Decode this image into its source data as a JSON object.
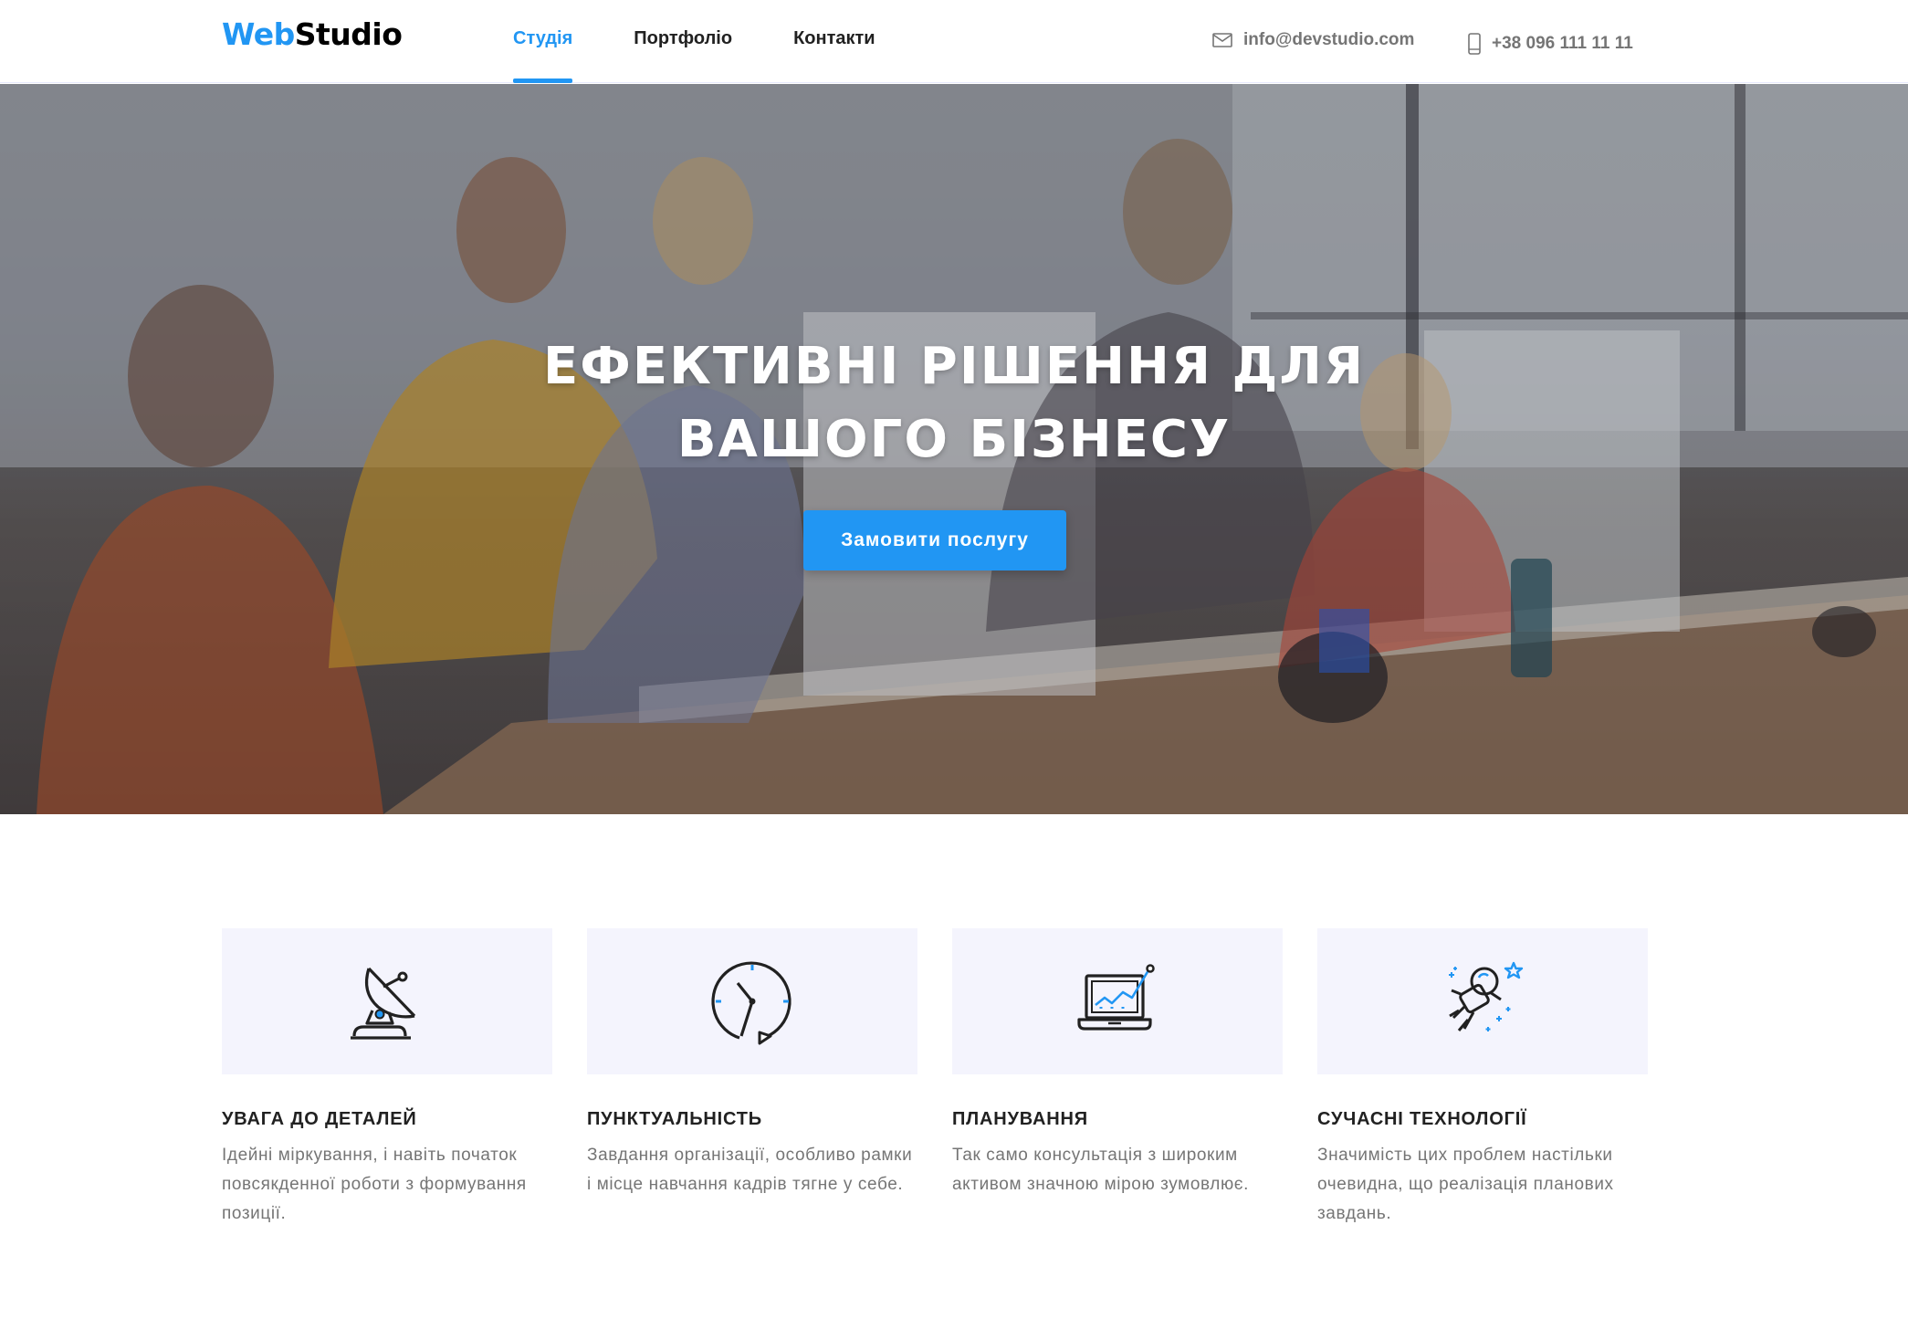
{
  "header": {
    "logo": {
      "part1": "Web",
      "part2": "Studio"
    },
    "nav": [
      {
        "label": "Студія",
        "active": true
      },
      {
        "label": "Портфоліо",
        "active": false
      },
      {
        "label": "Контакти",
        "active": false
      }
    ],
    "email": "info@devstudio.com",
    "phone": "+38 096 111 11 11"
  },
  "hero": {
    "title": "Ефективні рішення для вашого бізнесу",
    "button_label": "Замовити послугу"
  },
  "features": [
    {
      "icon": "satellite-dish-icon",
      "title": "Увага до деталей",
      "text": "Ідейні міркування, і навіть початок повсякденної роботи з формування позиції."
    },
    {
      "icon": "clock-icon",
      "title": "Пунктуальність",
      "text": "Завдання організації, особливо рамки і місце навчання кадрів тягне у себе."
    },
    {
      "icon": "laptop-chart-icon",
      "title": "Планування",
      "text": "Так само консультація з широким активом значною мірою зумовлює."
    },
    {
      "icon": "astronaut-icon",
      "title": "Сучасні технології",
      "text": "Значимість цих проблем настільки очевидна, що реалізація планових завдань."
    }
  ],
  "colors": {
    "accent": "#2196f3",
    "text": "#212121",
    "muted": "#757575",
    "feature_bg": "#f4f4fd"
  }
}
